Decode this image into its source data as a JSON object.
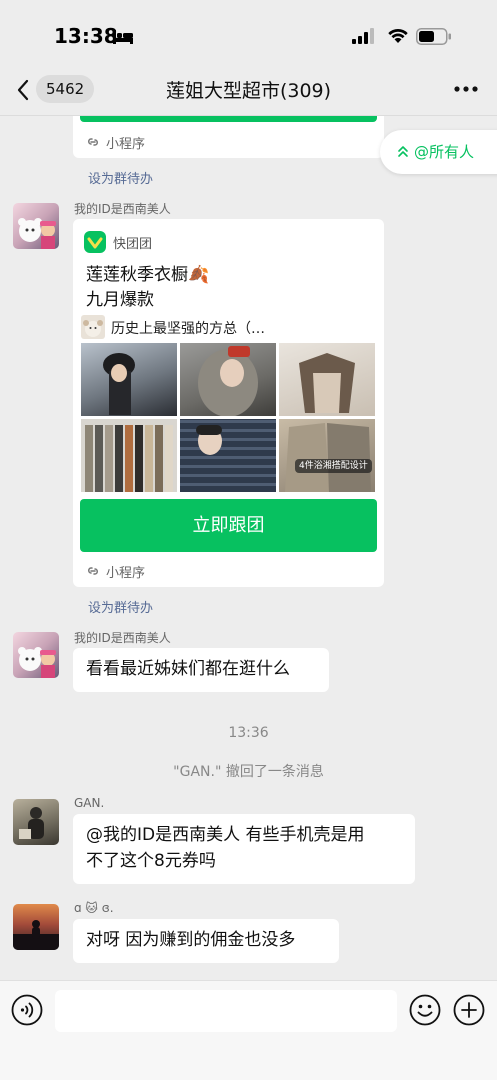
{
  "status": {
    "time": "13:38"
  },
  "nav": {
    "unread": "5462",
    "title": "莲姐大型超市(309)"
  },
  "mention": {
    "label": "@所有人"
  },
  "card1": {
    "mini_label": "小程序",
    "todo": "设为群待办"
  },
  "msg1": {
    "sender": "我的ID是西南美人",
    "app_name": "快团团",
    "title_line1": "莲莲秋季衣橱🍂",
    "title_line2": "九月爆款",
    "store": "历史上最坚强的方总（…",
    "photo_overlay": "4件浴湘搭配设计",
    "button": "立即跟团",
    "mini_label": "小程序",
    "todo": "设为群待办"
  },
  "msg2": {
    "sender": "我的ID是西南美人",
    "text": "看看最近姊妹们都在逛什么"
  },
  "time_divider": "13:36",
  "recall_note": "\"GAN.\" 撤回了一条消息",
  "msg3": {
    "sender": "GAN.",
    "line1": "@我的ID是西南美人 有些手机壳是用",
    "line2": "不了这个8元券吗"
  },
  "msg4": {
    "sender": "ɑ 🐱 ɞ.",
    "text": "对呀  因为赚到的佣金也没多"
  },
  "colors": {
    "accent": "#07c160",
    "link": "#576b95",
    "background": "#ededed"
  }
}
